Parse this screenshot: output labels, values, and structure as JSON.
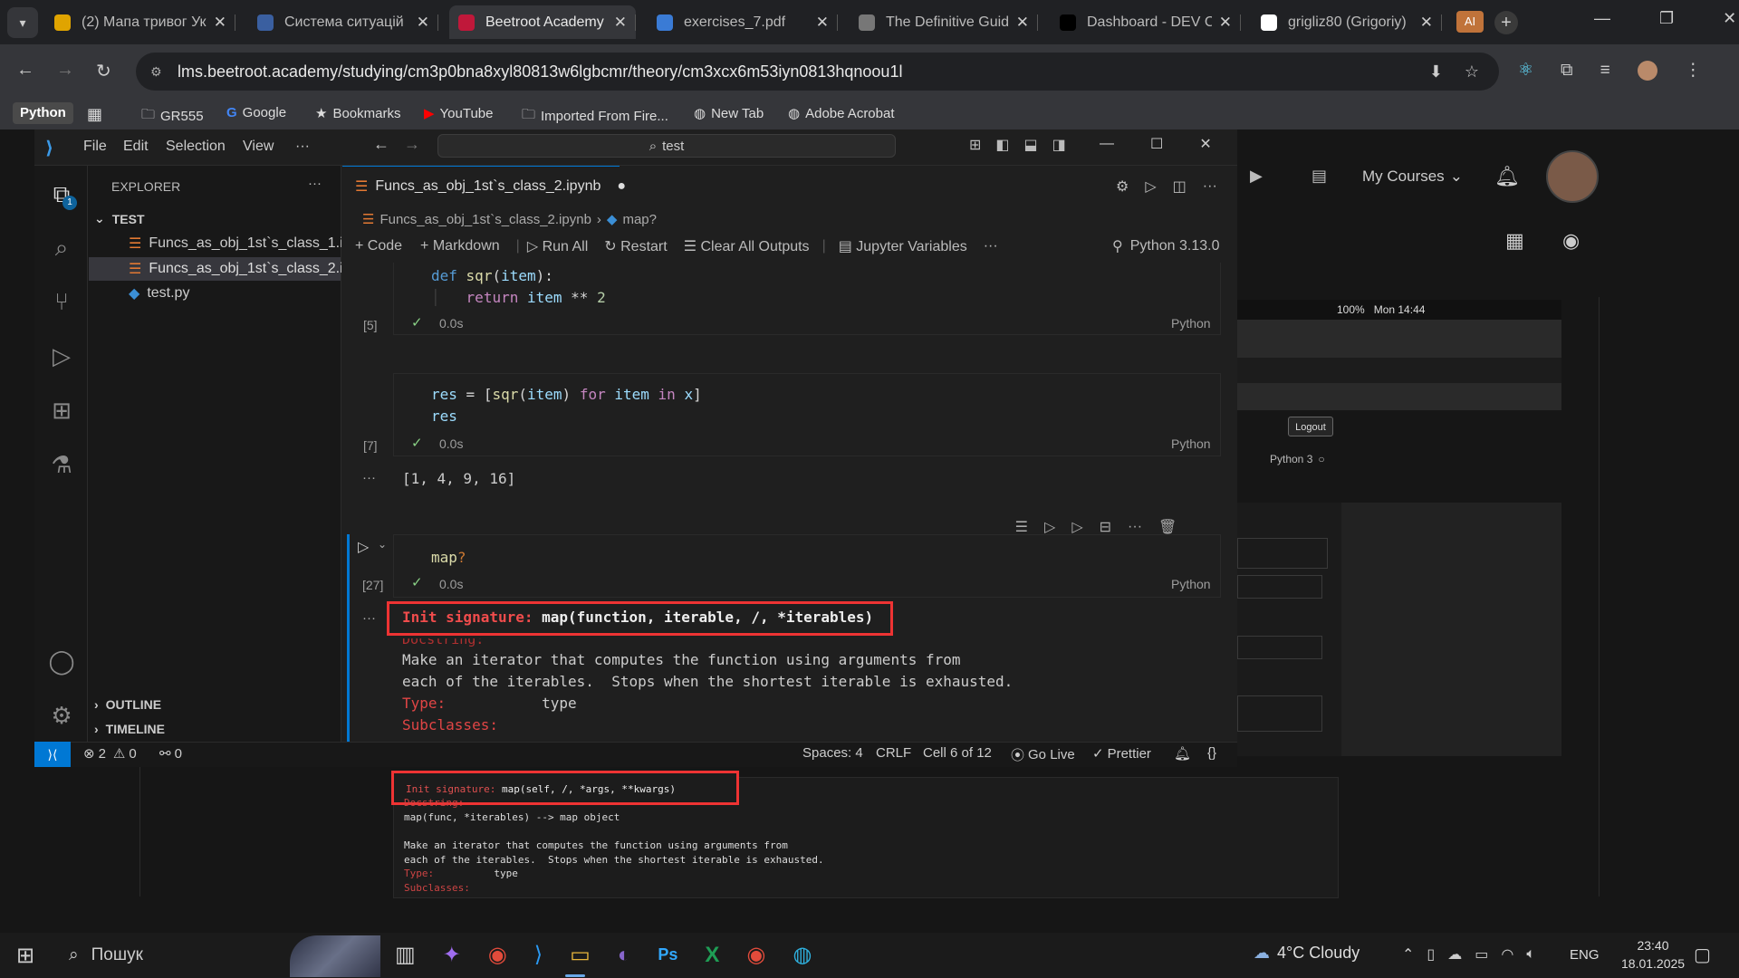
{
  "browser": {
    "tabs": [
      {
        "label": "(2) Мапа тривог Ук",
        "icon": "sun-icon",
        "color": "#e0a400"
      },
      {
        "label": "Система ситуацій",
        "icon": "shield-icon",
        "color": "#3a5fa0"
      },
      {
        "label": "Beetroot Academy |",
        "icon": "beet-icon",
        "color": "#c0183a"
      },
      {
        "label": "exercises_7.pdf",
        "icon": "pdf-icon",
        "color": "#3a7bd5"
      },
      {
        "label": "The Definitive Guid",
        "icon": "globe-icon",
        "color": "#777"
      },
      {
        "label": "Dashboard - DEV C",
        "icon": "dev-icon",
        "color": "#000"
      },
      {
        "label": "grigliz80 (Grigoriy)",
        "icon": "github-icon",
        "color": "#fff"
      }
    ],
    "ai_badge": "AI",
    "url": "lms.beetroot.academy/studying/cm3p0bna8xyl80813w6lgbcmr/theory/cm3xcx6m53iyn0813hqnoou1l",
    "bookmarks": [
      "Python",
      "GR555",
      "Google",
      "Bookmarks",
      "YouTube",
      "Imported From Fire...",
      "New Tab",
      "Adobe Acrobat"
    ]
  },
  "lms": {
    "my_courses": "My Courses"
  },
  "vscode": {
    "menu": [
      "File",
      "Edit",
      "Selection",
      "View",
      "···"
    ],
    "search": "test",
    "explorer_title": "EXPLORER",
    "folder": "TEST",
    "files": [
      "Funcs_as_obj_1st`s_class_1.i...",
      "Funcs_as_obj_1st`s_class_2.i...",
      "test.py"
    ],
    "outline": "OUTLINE",
    "timeline": "TIMELINE",
    "editor_tab": "Funcs_as_obj_1st`s_class_2.ipynb",
    "breadcrumb": [
      "Funcs_as_obj_1st`s_class_2.ipynb",
      "map?"
    ],
    "toolbar": {
      "code": "Code",
      "markdown": "Markdown",
      "run_all": "Run All",
      "restart": "Restart",
      "clear": "Clear All Outputs",
      "variables": "Jupyter Variables",
      "kernel": "Python 3.13.0"
    },
    "cells": [
      {
        "count": "[5]",
        "time": "0.0s",
        "lang": "Python"
      },
      {
        "count": "[7]",
        "time": "0.0s",
        "lang": "Python",
        "output": "[1, 4, 9, 16]"
      },
      {
        "count": "[27]",
        "time": "0.0s",
        "lang": "Python",
        "source": "map?"
      }
    ],
    "help_output": {
      "sig_label": "Init signature:",
      "sig_value": "map(function, iterable, /, *iterables)",
      "doc_label": "Docstring:",
      "doc_line1": "Make an iterator that computes the function using arguments from",
      "doc_line2": "each of the iterables.  Stops when the shortest iterable is exhausted.",
      "type_label": "Type:",
      "type_value": "type",
      "sub_label": "Subclasses:"
    },
    "status": {
      "errors": "2",
      "warnings": "0",
      "ports": "0",
      "spaces": "Spaces: 4",
      "eol": "CRLF",
      "cell": "Cell 6 of 12",
      "golive": "Go Live",
      "prettier": "Prettier"
    }
  },
  "embedded": {
    "macbar": [
      "100%",
      "Mon 14:44"
    ],
    "logout": "Logout",
    "kernel": "Python 3",
    "sig_label": "Init signature:",
    "sig_value": "map(self, /, *args, **kwargs)",
    "doc_label": "Docstring:",
    "doc_line0": "map(func, *iterables) --> map object",
    "doc_line1": "Make an iterator that computes the function using arguments from",
    "doc_line2": "each of the iterables.  Stops when the shortest iterable is exhausted.",
    "type_label": "Type:",
    "type_value": "type",
    "sub_label": "Subclasses:"
  },
  "taskbar": {
    "search": "Пошук",
    "weather": "4°C  Cloudy",
    "lang": "ENG",
    "time": "23:40",
    "date": "18.01.2025"
  }
}
